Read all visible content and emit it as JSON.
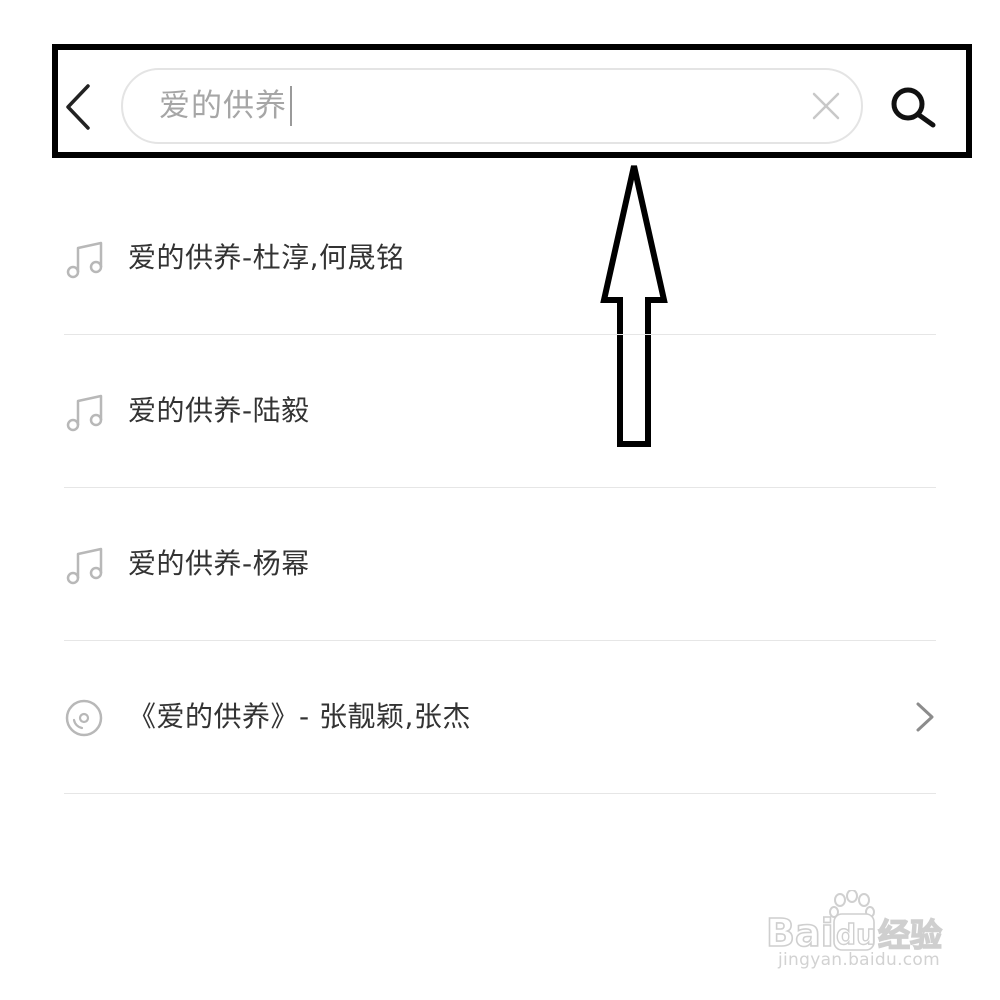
{
  "search": {
    "query": "爱的供养",
    "caret_visible": true
  },
  "results": [
    {
      "label": "爱的供养-杜淳,何晟铭",
      "type": "song",
      "icon": "music-note-icon",
      "has_chevron": false
    },
    {
      "label": "爱的供养-陆毅",
      "type": "song",
      "icon": "music-note-icon",
      "has_chevron": false
    },
    {
      "label": "爱的供养-杨幂",
      "type": "song",
      "icon": "music-note-icon",
      "has_chevron": false
    },
    {
      "label": "《爱的供养》- 张靓颖,张杰",
      "type": "album",
      "icon": "album-disc-icon",
      "has_chevron": true
    }
  ],
  "annotation": {
    "highlight_color": "#000000",
    "arrow_direction": "up"
  },
  "watermark": {
    "logo_text": "Bai du 经验",
    "url": "jingyan.baidu.com"
  },
  "colors": {
    "text_primary": "#333333",
    "text_placeholder": "#a6a6a6",
    "icon_muted": "#b8b8b8",
    "divider": "#e6e6e6",
    "field_border": "#e4e4e4"
  }
}
